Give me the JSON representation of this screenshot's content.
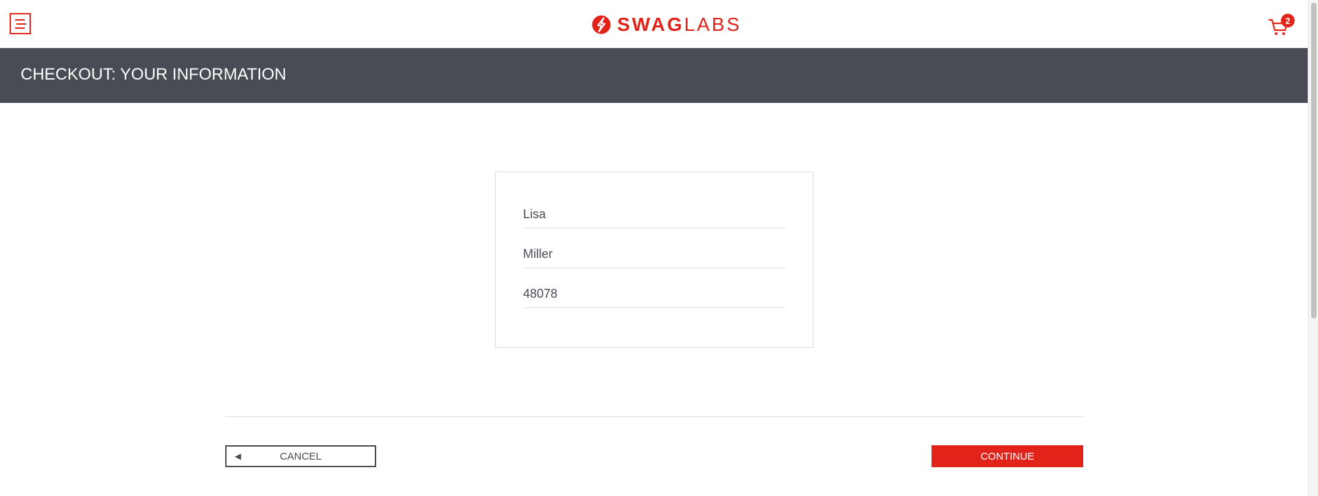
{
  "header": {
    "logo_brand": "SWAG",
    "logo_suffix": "LABS",
    "cart_count": "2",
    "icons": {
      "menu": "hamburger-menu-icon",
      "logo": "swag-labs-logo-icon",
      "cart": "shopping-cart-icon"
    }
  },
  "subheader": {
    "title": "CHECKOUT: YOUR INFORMATION"
  },
  "form": {
    "first_name": "Lisa",
    "last_name": "Miller",
    "postal_code": "48078"
  },
  "actions": {
    "cancel_label": "CANCEL",
    "continue_label": "CONTINUE",
    "cancel_icon": "back-arrow-icon"
  },
  "colors": {
    "accent": "#e2231a",
    "subheader_bg": "#474c55",
    "text": "#484c55",
    "border": "#dddddd"
  }
}
